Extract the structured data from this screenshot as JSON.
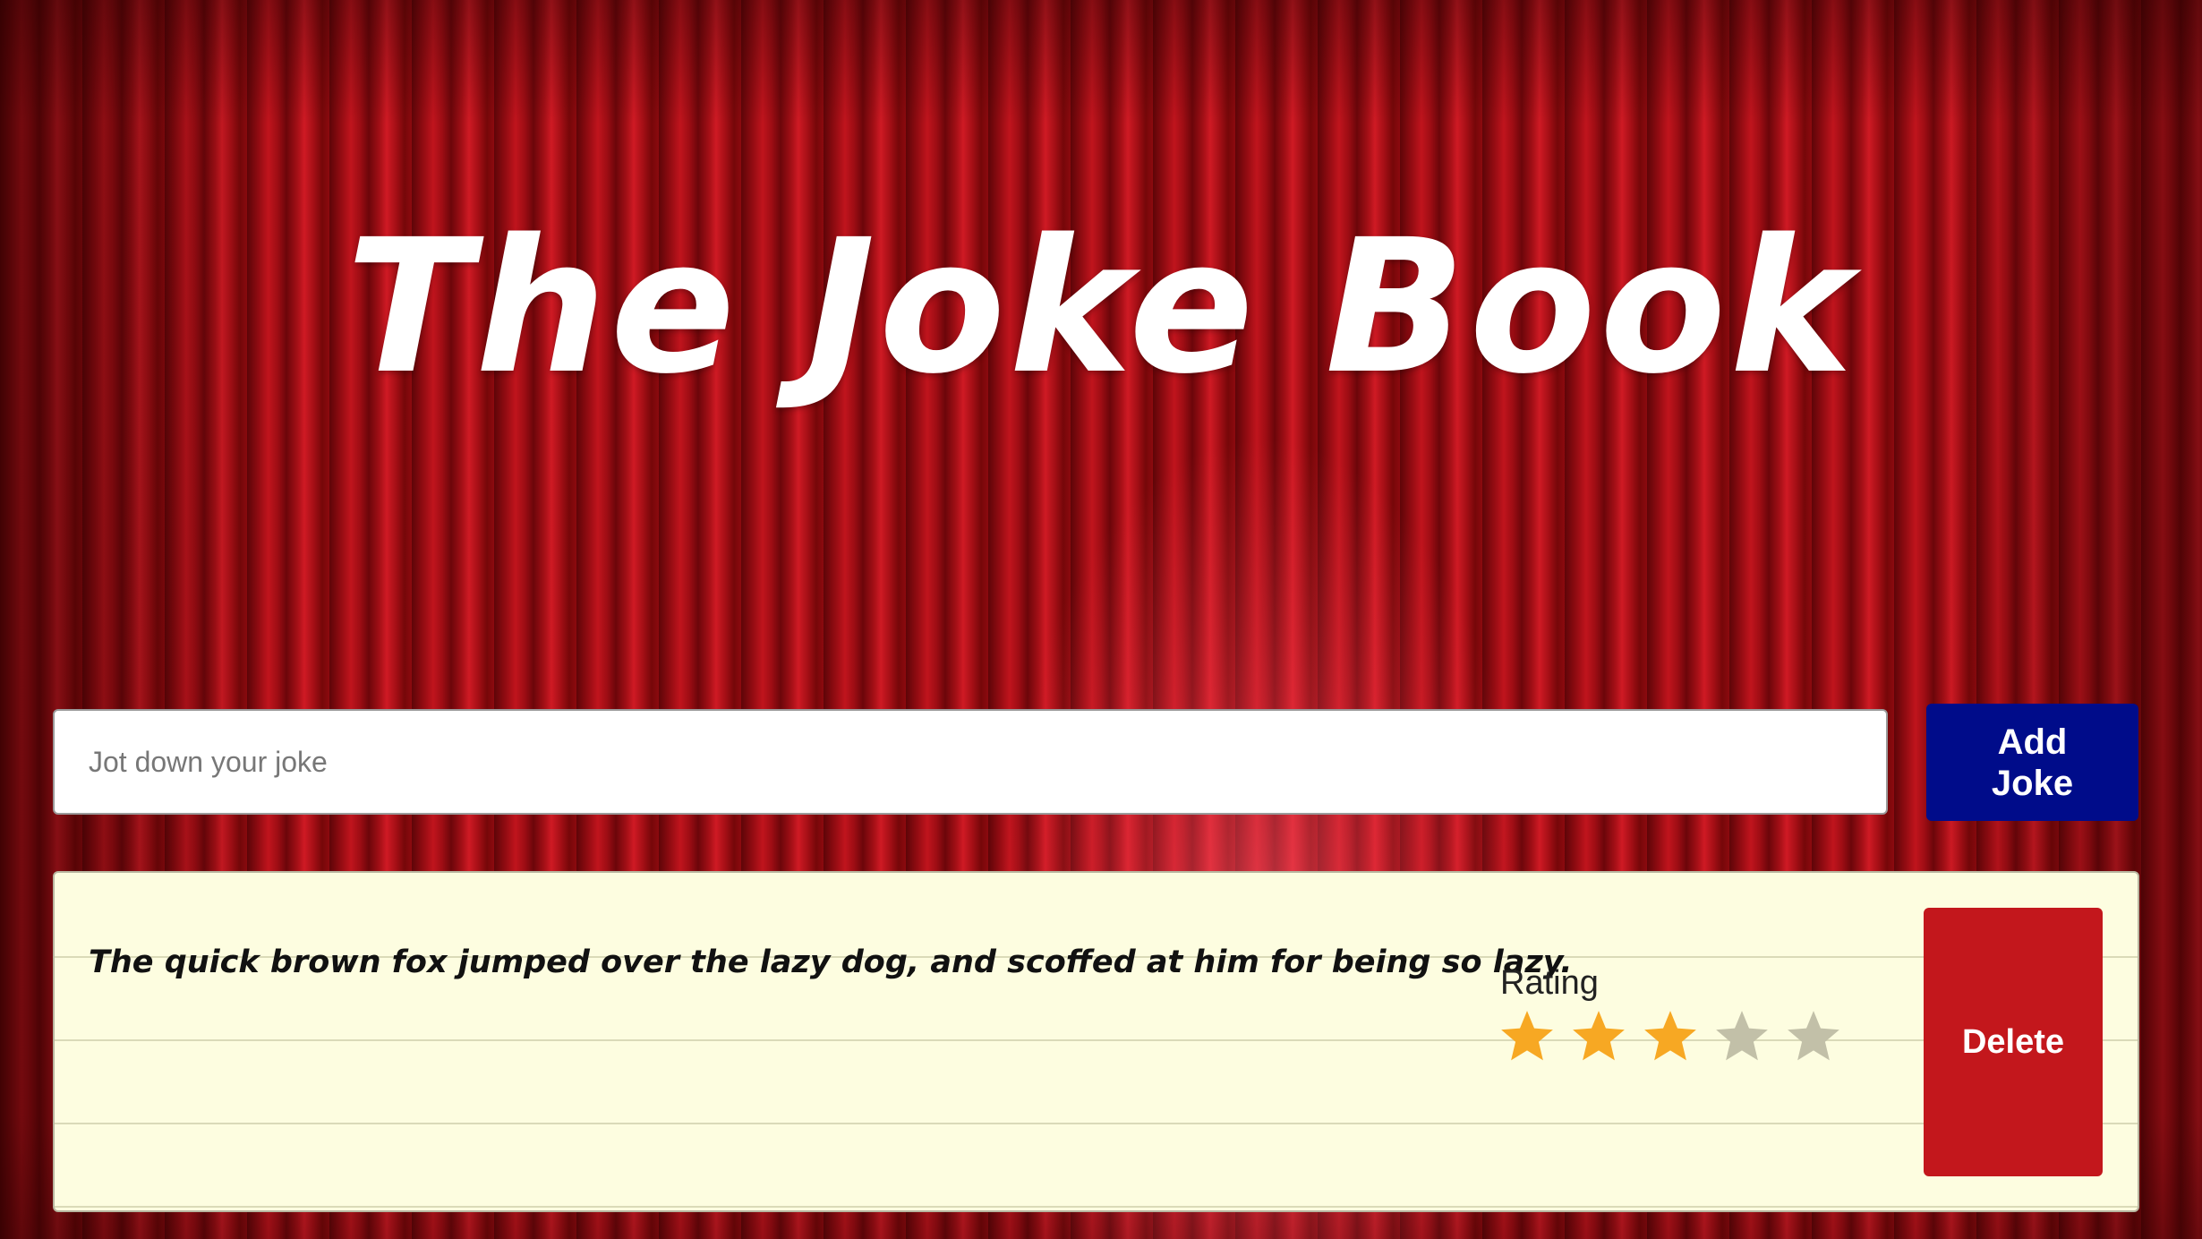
{
  "header": {
    "title": "The Joke Book"
  },
  "composer": {
    "placeholder": "Jot down your joke",
    "value": "",
    "add_button_label": "Add Joke"
  },
  "jokes": [
    {
      "text": "The quick brown fox jumped over the lazy dog, and scoffed at him for being so lazy.",
      "rating_label": "Rating",
      "rating": 3,
      "rating_max": 5,
      "delete_label": "Delete"
    }
  ],
  "colors": {
    "curtain": "#8e0c10",
    "add_button": "#000c8a",
    "delete_button": "#c3171c",
    "card_background": "#fdfde0",
    "star_filled": "#f7a823",
    "star_empty": "#c2c0a8"
  },
  "icons": {
    "rating_star": "star-icon"
  }
}
